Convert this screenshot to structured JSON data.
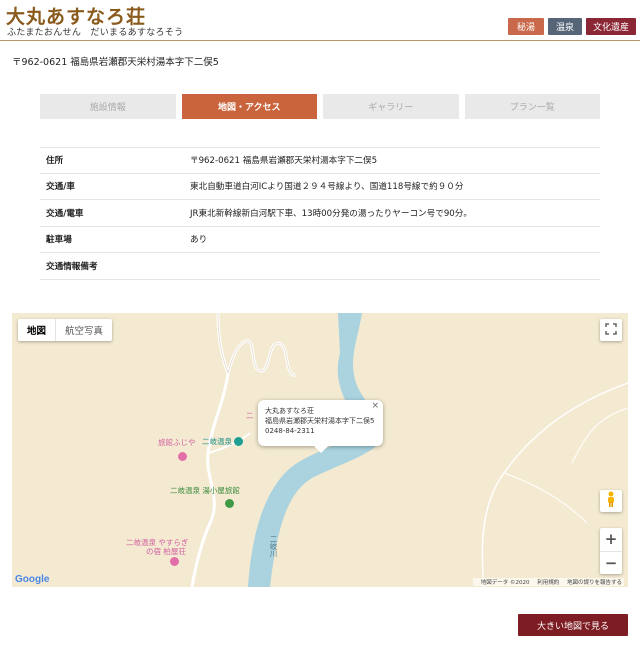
{
  "header": {
    "title": "大丸あすなろ荘",
    "subtitle": "ふたまたおんせん　だいまるあすなろそう",
    "badges": [
      "秘湯",
      "温泉",
      "文化遺産"
    ]
  },
  "address_line": "〒962-0621 福島県岩瀬郡天栄村湯本字下二俣5",
  "tabs": [
    {
      "label": "施設情報",
      "active": false
    },
    {
      "label": "地図・アクセス",
      "active": true
    },
    {
      "label": "ギャラリー",
      "active": false
    },
    {
      "label": "プラン一覧",
      "active": false
    }
  ],
  "info_rows": [
    {
      "key": "住所",
      "value": "〒962-0621 福島県岩瀬郡天栄村湯本字下二俣5"
    },
    {
      "key": "交通/車",
      "value": "東北自動車道白河ICより国道２９４号線より、国道118号線で約９０分"
    },
    {
      "key": "交通/電車",
      "value": "JR東北新幹線新白河駅下車、13時00分発の湯ったりヤーコン号で90分。"
    },
    {
      "key": "駐車場",
      "value": "あり"
    },
    {
      "key": "交通情報備考",
      "value": ""
    }
  ],
  "map": {
    "type_buttons": [
      "地図",
      "航空写真"
    ],
    "infowindow": {
      "name": "大丸あすなろ荘",
      "address": "福島県岩瀬郡天栄村湯本字下二俣5",
      "phone": "0248-84-2311",
      "close": "×"
    },
    "pois": {
      "ryokan_fujiya": "旅館ふじや",
      "futamata_onsen": "二岐温泉",
      "koyakan": "二岐温泉 湯小屋旅館",
      "yasuragi_1": "二岐温泉 やすらぎ",
      "yasuragi_2": "の宿 柏屋荘",
      "river": "二岐川",
      "partial": "二"
    },
    "zoom_in": "+",
    "zoom_out": "−",
    "logo": "Google",
    "attribution": {
      "data": "地図データ ©2020",
      "terms": "利用規約",
      "report": "地図の誤りを報告する"
    }
  },
  "big_map_button": "大きい地図で見る",
  "colors": {
    "accent": "#c9643c",
    "title": "#8a5a1c",
    "river": "#aad3df",
    "map_bg": "#f4ead2",
    "button": "#7d1c22"
  },
  "icons": {
    "fullscreen": "fullscreen-icon",
    "pegman": "pegman-icon"
  }
}
